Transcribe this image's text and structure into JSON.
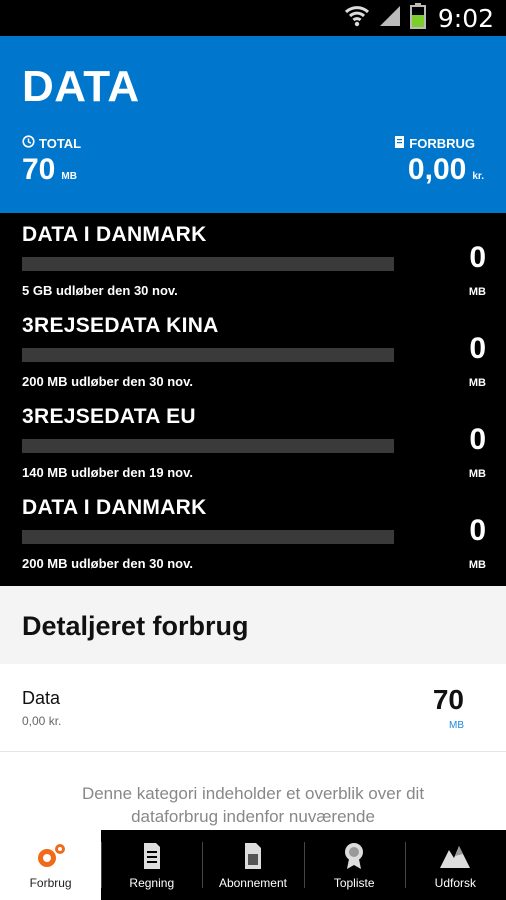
{
  "status_bar": {
    "time": "9:02",
    "icons": [
      "wifi-icon",
      "signal-icon",
      "battery-icon"
    ]
  },
  "header": {
    "title": "DATA",
    "total": {
      "label": "TOTAL",
      "value": "70",
      "unit": "MB",
      "icon": "clock-icon"
    },
    "usage": {
      "label": "FORBRUG",
      "value": "0,00",
      "unit": "kr.",
      "icon": "receipt-icon"
    },
    "background": "#0077cc"
  },
  "data_rows": [
    {
      "title": "DATA I DANMARK",
      "subtitle": "5 GB udløber den 30 nov.",
      "value": "0",
      "unit": "MB",
      "used_fraction": 0
    },
    {
      "title": "3REJSEDATA KINA",
      "subtitle": "200 MB udløber den 30 nov.",
      "value": "0",
      "unit": "MB",
      "used_fraction": 0
    },
    {
      "title": "3REJSEDATA EU",
      "subtitle": "140 MB udløber den 19 nov.",
      "value": "0",
      "unit": "MB",
      "used_fraction": 0
    },
    {
      "title": "DATA I DANMARK",
      "subtitle": "200 MB udløber den 30 nov.",
      "value": "0",
      "unit": "MB",
      "used_fraction": 0
    }
  ],
  "detail": {
    "heading": "Detaljeret forbrug",
    "row": {
      "name": "Data",
      "price": "0,00 kr.",
      "value": "70",
      "unit": "MB"
    },
    "description": "Denne kategori indeholder et overblik over dit dataforbrug indenfor nuværende"
  },
  "bottom_nav": [
    {
      "label": "Forbrug",
      "icon": "usage-icon",
      "active": true
    },
    {
      "label": "Regning",
      "icon": "bill-icon",
      "active": false
    },
    {
      "label": "Abonnement",
      "icon": "sim-card-icon",
      "active": false
    },
    {
      "label": "Topliste",
      "icon": "award-icon",
      "active": false
    },
    {
      "label": "Udforsk",
      "icon": "explore-icon",
      "active": false
    }
  ]
}
